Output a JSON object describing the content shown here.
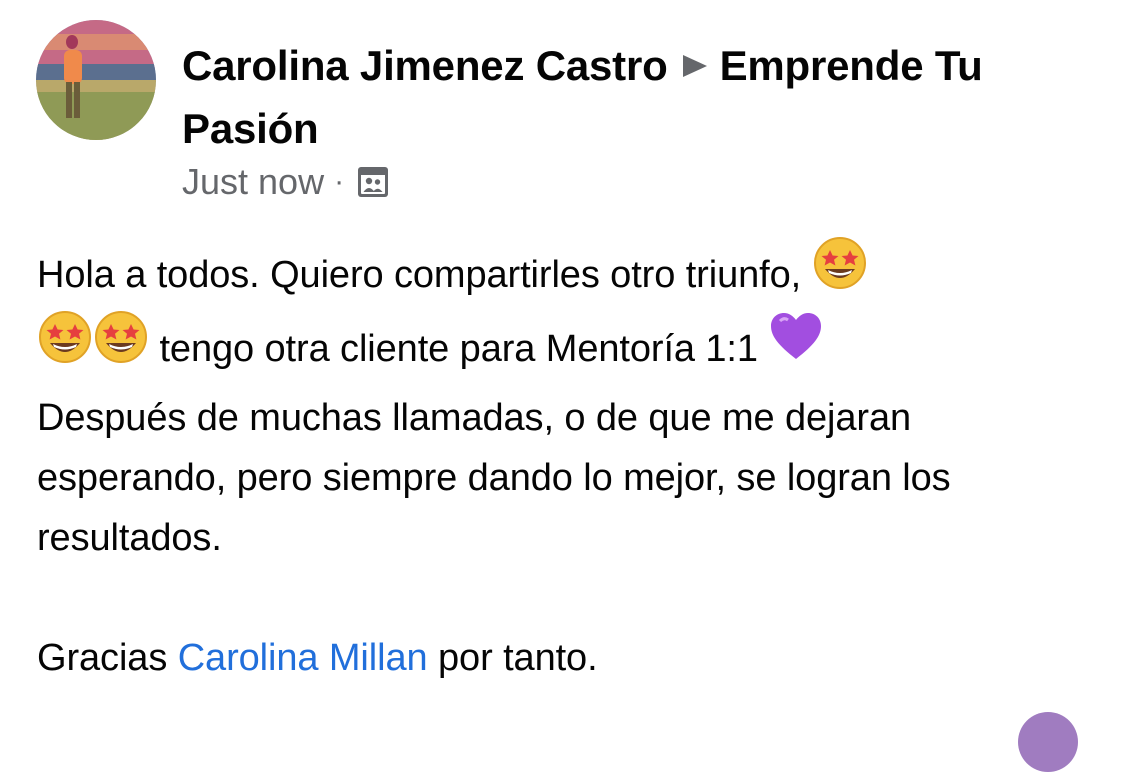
{
  "post": {
    "author": "Carolina Jimenez Castro",
    "group": "Emprende Tu Pasión",
    "timestamp": "Just now",
    "separator": "·",
    "audience_icon": "group-audience-icon",
    "body": {
      "line1": "Hola a todos. Quiero compartirles otro triunfo,",
      "line2": "tengo otra cliente para Mentoría 1:1",
      "line3": "Después de muchas llamadas, o de que me dejaran esperando, pero siempre dando lo mejor, se logran los resultados.",
      "thanks_prefix": "Gracias",
      "mention": "Carolina Millan",
      "thanks_suffix": "por tanto."
    },
    "emojis": {
      "star_struck": "star-struck-emoji",
      "purple_heart": "purple-heart-emoji"
    }
  },
  "colors": {
    "mention": "#216fdb",
    "meta": "#65676b",
    "text": "#050505"
  }
}
